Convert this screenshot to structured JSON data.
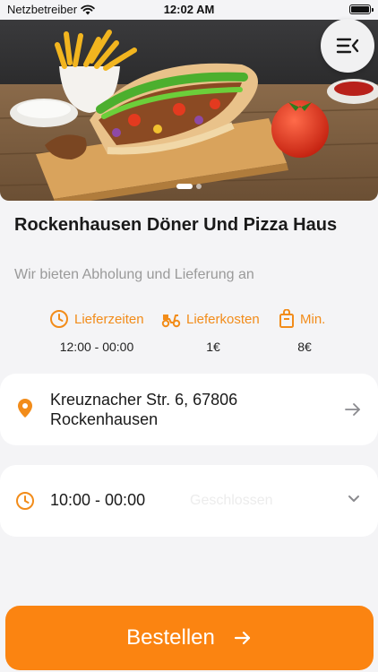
{
  "status_bar": {
    "carrier": "Netzbetreiber",
    "time": "12:02 AM"
  },
  "hero": {
    "slides": 2,
    "active_slide": 0
  },
  "restaurant": {
    "name": "Rockenhausen Döner Und Pizza Haus",
    "tagline": "Wir bieten Abholung und Lieferung an"
  },
  "info": {
    "delivery_time": {
      "label": "Lieferzeiten",
      "value": "12:00 - 00:00"
    },
    "delivery_cost": {
      "label": "Lieferkosten",
      "value": "1€"
    },
    "minimum": {
      "label": "Min.",
      "value": "8€"
    }
  },
  "address": {
    "line1": "Kreuznacher Str. 6, 67806",
    "line2": "Rockenhausen"
  },
  "hours": {
    "time": "10:00 - 00:00",
    "status": "Geschlossen"
  },
  "order_button": {
    "label": "Bestellen"
  },
  "colors": {
    "accent": "#fb8411",
    "icon_orange": "#f28c1a",
    "background": "#f4f4f6"
  },
  "icons": [
    "wifi-icon",
    "battery-icon",
    "menu-icon",
    "clock-icon",
    "scooter-icon",
    "bag-icon",
    "location-pin-icon",
    "arrow-right-icon",
    "chevron-down-icon"
  ]
}
